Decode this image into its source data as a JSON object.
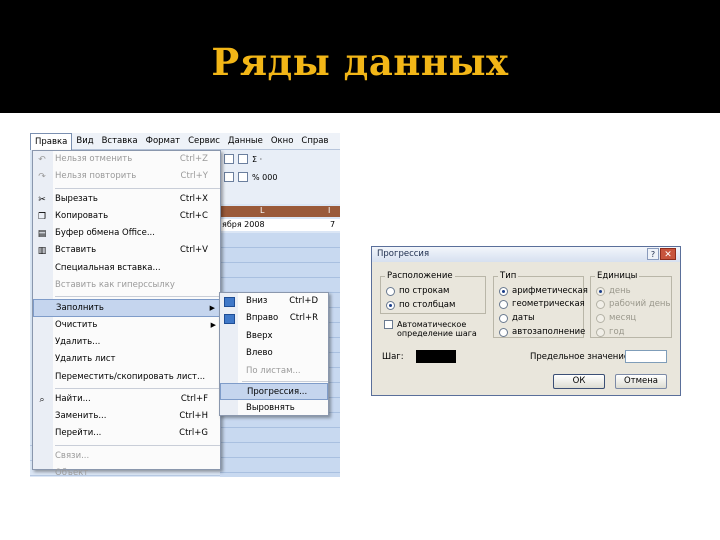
{
  "slide": {
    "title": "Ряды данных"
  },
  "menubar": [
    "Правка",
    "Вид",
    "Вставка",
    "Формат",
    "Сервис",
    "Данные",
    "Окно",
    "Справ"
  ],
  "toolbar": {
    "row1": "Σ ·",
    "row2": "% 000"
  },
  "sheet": {
    "col_headers": [
      "L",
      "I"
    ],
    "cell_date": "ября 2008",
    "cell_value": "7"
  },
  "edit_menu": {
    "items": [
      {
        "label": "Нельзя отменить",
        "shortcut": "Ctrl+Z",
        "icon": "undo-icon",
        "glyph": "↶",
        "disabled": true
      },
      {
        "label": "Нельзя повторить",
        "shortcut": "Ctrl+Y",
        "icon": "redo-icon",
        "glyph": "↷",
        "disabled": true
      },
      {
        "sep": true
      },
      {
        "label": "Вырезать",
        "shortcut": "Ctrl+X",
        "icon": "scissors-icon",
        "glyph": "✂"
      },
      {
        "label": "Копировать",
        "shortcut": "Ctrl+C",
        "icon": "copy-icon",
        "glyph": "❐"
      },
      {
        "label": "Буфер обмена Office...",
        "shortcut": "",
        "icon": "clipboard-icon",
        "glyph": "▤"
      },
      {
        "label": "Вставить",
        "shortcut": "Ctrl+V",
        "icon": "paste-icon",
        "glyph": "▥"
      },
      {
        "label": "Специальная вставка...",
        "shortcut": ""
      },
      {
        "label": "Вставить как гиперссылку",
        "shortcut": "",
        "disabled": true
      },
      {
        "sep": true
      },
      {
        "label": "Заполнить",
        "shortcut": "",
        "submenu": true,
        "highlighted": true
      },
      {
        "label": "Очистить",
        "shortcut": "",
        "submenu": true
      },
      {
        "label": "Удалить...",
        "shortcut": ""
      },
      {
        "label": "Удалить лист",
        "shortcut": ""
      },
      {
        "label": "Переместить/скопировать лист...",
        "shortcut": ""
      },
      {
        "sep": true
      },
      {
        "label": "Найти...",
        "shortcut": "Ctrl+F",
        "icon": "binoculars-icon",
        "glyph": "⌕"
      },
      {
        "label": "Заменить...",
        "shortcut": "Ctrl+H"
      },
      {
        "label": "Перейти...",
        "shortcut": "Ctrl+G"
      },
      {
        "sep": true
      },
      {
        "label": "Связи...",
        "shortcut": "",
        "disabled": true
      },
      {
        "label": "Объект",
        "shortcut": "",
        "disabled": true
      }
    ]
  },
  "fill_submenu": {
    "items": [
      {
        "label": "Вниз",
        "shortcut": "Ctrl+D",
        "icon": "fill-down-icon"
      },
      {
        "label": "Вправо",
        "shortcut": "Ctrl+R",
        "icon": "fill-right-icon"
      },
      {
        "label": "Вверх",
        "shortcut": ""
      },
      {
        "label": "Влево",
        "shortcut": ""
      },
      {
        "label": "По листам...",
        "shortcut": "",
        "disabled": true
      },
      {
        "sep": true
      },
      {
        "label": "Прогрессия...",
        "shortcut": "",
        "highlighted": true
      },
      {
        "label": "Выровнять",
        "shortcut": ""
      }
    ]
  },
  "dialog": {
    "title": "Прогрессия",
    "help": "?",
    "close": "✕",
    "location": {
      "legend": "Расположение",
      "options": [
        "по строкам",
        "по столбцам"
      ],
      "selected": 1
    },
    "type": {
      "legend": "Тип",
      "options": [
        "арифметическая",
        "геометрическая",
        "даты",
        "автозаполнение"
      ],
      "selected": 0
    },
    "units": {
      "legend": "Единицы",
      "options": [
        "день",
        "рабочий день",
        "месяц",
        "год"
      ],
      "selected": 0
    },
    "auto_step": "Автоматическое определение шага",
    "step_label": "Шаг:",
    "limit_label": "Предельное значение:",
    "ok": "ОК",
    "cancel": "Отмена"
  }
}
